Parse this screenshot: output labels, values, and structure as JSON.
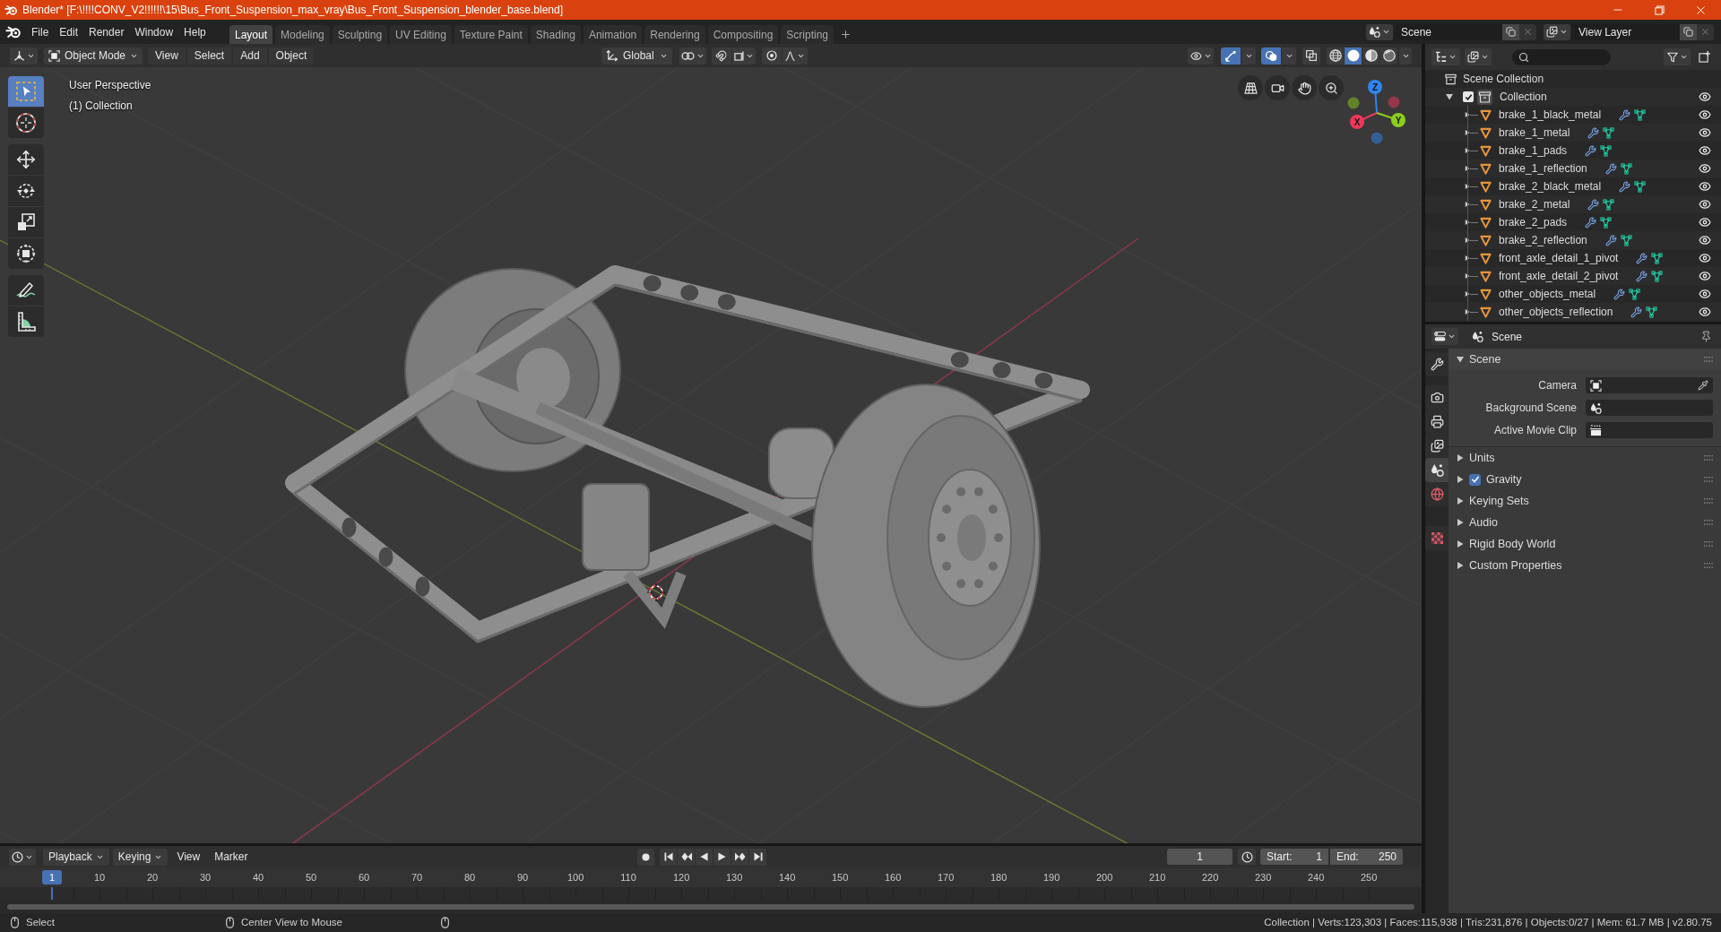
{
  "window": {
    "title": "Blender* [F:\\!!!!CONV_V2!!!!!!\\15\\Bus_Front_Suspension_max_vray\\Bus_Front_Suspension_blender_base.blend]"
  },
  "menu_bar": [
    "File",
    "Edit",
    "Render",
    "Window",
    "Help"
  ],
  "workspace_tabs": [
    {
      "label": "Layout",
      "selected": true
    },
    {
      "label": "Modeling",
      "selected": false
    },
    {
      "label": "Sculpting",
      "selected": false
    },
    {
      "label": "UV Editing",
      "selected": false
    },
    {
      "label": "Texture Paint",
      "selected": false
    },
    {
      "label": "Shading",
      "selected": false
    },
    {
      "label": "Animation",
      "selected": false
    },
    {
      "label": "Rendering",
      "selected": false
    },
    {
      "label": "Compositing",
      "selected": false
    },
    {
      "label": "Scripting",
      "selected": false
    }
  ],
  "scene_selector": {
    "value": "Scene"
  },
  "view_layer_selector": {
    "value": "View Layer"
  },
  "viewport": {
    "header": {
      "mode": "Object Mode",
      "menus": [
        "View",
        "Select",
        "Add",
        "Object"
      ],
      "orientation": "Global",
      "snap": {
        "on": false
      },
      "proportional": {
        "on": false
      },
      "gizmos": {
        "on": true
      },
      "overlays": {
        "on": true
      },
      "xray": {
        "on": false
      },
      "shading": [
        {
          "kind": "wireframe",
          "selected": false
        },
        {
          "kind": "solid",
          "selected": true
        },
        {
          "kind": "material",
          "selected": false
        },
        {
          "kind": "rendered",
          "selected": false
        }
      ]
    },
    "tools": [
      {
        "kind": "select",
        "selected": true
      },
      {
        "kind": "cursor",
        "selected": false
      },
      {
        "kind": "move",
        "selected": false
      },
      {
        "kind": "rotate",
        "selected": false
      },
      {
        "kind": "scale",
        "selected": false
      },
      {
        "kind": "transform",
        "selected": false
      },
      {
        "kind": "annotate",
        "selected": false
      },
      {
        "kind": "measure",
        "selected": false
      }
    ],
    "overlay": {
      "view": "User Perspective",
      "collection": "(1) Collection"
    },
    "gizmo": [
      {
        "label": "Z",
        "color": "#2f85f0"
      },
      {
        "label": "X",
        "color": "#f0375a"
      },
      {
        "label": "Y",
        "color": "#8bcd1c"
      }
    ]
  },
  "outliner": {
    "root": "Scene Collection",
    "collections": [
      {
        "name": "Collection",
        "checked": true,
        "expanded": true,
        "children": [
          {
            "name": "brake_1_black_metal",
            "expanded": false
          },
          {
            "name": "brake_1_metal",
            "expanded": false
          },
          {
            "name": "brake_1_pads",
            "expanded": false
          },
          {
            "name": "brake_1_reflection",
            "expanded": false
          },
          {
            "name": "brake_2_black_metal",
            "expanded": false
          },
          {
            "name": "brake_2_metal",
            "expanded": false
          },
          {
            "name": "brake_2_pads",
            "expanded": false
          },
          {
            "name": "brake_2_reflection",
            "expanded": false
          },
          {
            "name": "front_axle_detail_1_pivot",
            "expanded": false
          },
          {
            "name": "front_axle_detail_2_pivot",
            "expanded": false
          },
          {
            "name": "other_objects_metal",
            "expanded": false
          },
          {
            "name": "other_objects_reflection",
            "expanded": false
          }
        ]
      }
    ]
  },
  "properties": {
    "context": "Scene",
    "tabs": [
      {
        "kind": "tool",
        "selected": false
      },
      {
        "kind": "render",
        "selected": false
      },
      {
        "kind": "output",
        "selected": false
      },
      {
        "kind": "view_layer",
        "selected": false
      },
      {
        "kind": "scene",
        "selected": true
      },
      {
        "kind": "world",
        "selected": false
      },
      {
        "kind": "texture",
        "selected": false
      }
    ],
    "panels": [
      {
        "title": "Scene",
        "kind": "fields",
        "expanded": true,
        "fields": [
          {
            "label": "Camera",
            "kind": "object"
          },
          {
            "label": "Background Scene",
            "kind": "scene"
          },
          {
            "label": "Active Movie Clip",
            "kind": "clip"
          }
        ]
      },
      {
        "title": "Units",
        "kind": "plain",
        "expanded": false
      },
      {
        "title": "Gravity",
        "kind": "toggle",
        "expanded": false,
        "checked": true
      },
      {
        "title": "Keying Sets",
        "kind": "plain",
        "expanded": false
      },
      {
        "title": "Audio",
        "kind": "plain",
        "expanded": false
      },
      {
        "title": "Rigid Body World",
        "kind": "plain",
        "expanded": false
      },
      {
        "title": "Custom Properties",
        "kind": "plain",
        "expanded": false
      }
    ]
  },
  "timeline": {
    "menus": [
      {
        "label": "Playback",
        "kind": "dropdown"
      },
      {
        "label": "Keying",
        "kind": "dropdown"
      },
      {
        "label": "View",
        "kind": "menu"
      },
      {
        "label": "Marker",
        "kind": "menu"
      }
    ],
    "current_frame": "1",
    "start_label": "Start:",
    "start": "1",
    "end_label": "End:",
    "end": "250",
    "ruler": [
      {
        "label": "1",
        "selected": true
      },
      {
        "label": "10",
        "selected": false
      },
      {
        "label": "20",
        "selected": false
      },
      {
        "label": "30",
        "selected": false
      },
      {
        "label": "40",
        "selected": false
      },
      {
        "label": "50",
        "selected": false
      },
      {
        "label": "60",
        "selected": false
      },
      {
        "label": "70",
        "selected": false
      },
      {
        "label": "80",
        "selected": false
      },
      {
        "label": "90",
        "selected": false
      },
      {
        "label": "100",
        "selected": false
      },
      {
        "label": "110",
        "selected": false
      },
      {
        "label": "120",
        "selected": false
      },
      {
        "label": "130",
        "selected": false
      },
      {
        "label": "140",
        "selected": false
      },
      {
        "label": "150",
        "selected": false
      },
      {
        "label": "160",
        "selected": false
      },
      {
        "label": "170",
        "selected": false
      },
      {
        "label": "180",
        "selected": false
      },
      {
        "label": "190",
        "selected": false
      },
      {
        "label": "200",
        "selected": false
      },
      {
        "label": "210",
        "selected": false
      },
      {
        "label": "220",
        "selected": false
      },
      {
        "label": "230",
        "selected": false
      },
      {
        "label": "240",
        "selected": false
      },
      {
        "label": "250",
        "selected": false
      }
    ]
  },
  "status_bar": {
    "hints": [
      "Select",
      "Center View to Mouse"
    ],
    "stats": "Collection | Verts:123,303 | Faces:115,938 | Tris:231,876 | Objects:0/27 | Mem: 61.7 MB | v2.80.75"
  }
}
